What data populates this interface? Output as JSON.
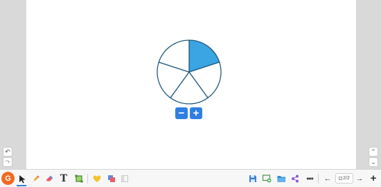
{
  "app": {
    "logo_letter": "G",
    "accent_color": "#2f7fe0",
    "logo_color": "#ef6b22"
  },
  "canvas": {
    "fraction_figure": {
      "slices_total": 5,
      "slices_shaded": 1,
      "shade_color": "#3ba4e2",
      "outline_color": "#1f5a7c"
    },
    "zoom_out_label": "−",
    "zoom_in_label": "+"
  },
  "side_controls": {
    "undo_icon": "↶",
    "redo_icon": "↷",
    "scroll_up_icon": "⌃",
    "scroll_down_icon": "⌄"
  },
  "toolbar": {
    "left_tools": [
      {
        "name": "select-tool",
        "icon": "arrow-pointer-icon",
        "active": true
      },
      {
        "name": "pencil-tool",
        "icon": "pencil-icon"
      },
      {
        "name": "eraser-tool",
        "icon": "eraser-icon"
      },
      {
        "name": "text-tool",
        "icon": "text-icon",
        "label": "T"
      },
      {
        "name": "shape-tool",
        "icon": "square-shape-icon"
      },
      {
        "name": "sticky-tool",
        "icon": "heart-icon"
      },
      {
        "name": "media-tool",
        "icon": "media-icon"
      },
      {
        "name": "panel-tool",
        "icon": "panel-icon"
      }
    ],
    "right_tools": [
      {
        "name": "save-tool",
        "icon": "save-icon"
      },
      {
        "name": "add-screen-tool",
        "icon": "add-screen-icon"
      },
      {
        "name": "open-folder-tool",
        "icon": "folder-icon"
      },
      {
        "name": "share-tool",
        "icon": "share-icon"
      },
      {
        "name": "more-tool",
        "icon": "more-icon",
        "label": "•••"
      }
    ],
    "page_nav": {
      "prev_icon": "←",
      "next_icon": "→",
      "current_page": "2/2",
      "add_page_label": "+"
    }
  }
}
